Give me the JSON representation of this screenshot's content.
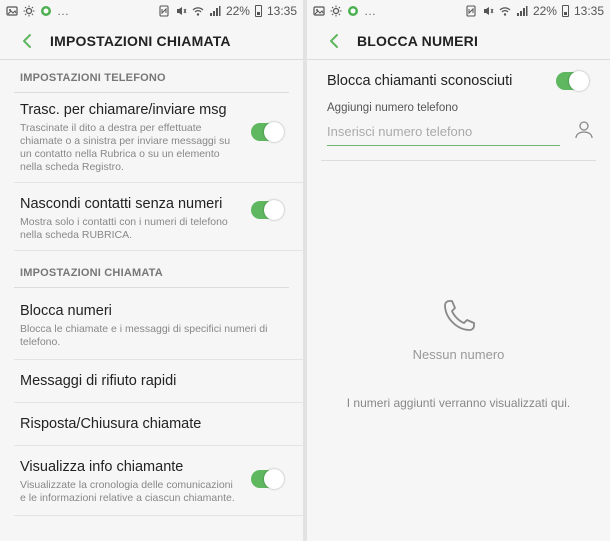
{
  "status_bar": {
    "battery": "22%",
    "time": "13:35"
  },
  "left": {
    "title": "IMPOSTAZIONI CHIAMATA",
    "section_phone": "IMPOSTAZIONI TELEFONO",
    "section_call": "IMPOSTAZIONI CHIAMATA",
    "items": [
      {
        "title": "Trasc. per chiamare/inviare msg",
        "subtitle": "Trascinate il dito a destra per effettuate chiamate o a sinistra per inviare messaggi su un contatto nella Rubrica o su un elemento nella scheda Registro.",
        "toggle": true
      },
      {
        "title": "Nascondi contatti senza numeri",
        "subtitle": "Mostra solo i contatti con i numeri di telefono nella scheda RUBRICA.",
        "toggle": true
      },
      {
        "title": "Blocca numeri",
        "subtitle": "Blocca le chiamate e i messaggi di specifici numeri di telefono."
      },
      {
        "title": "Messaggi di rifiuto rapidi"
      },
      {
        "title": "Risposta/Chiusura chiamate"
      },
      {
        "title": "Visualizza info chiamante",
        "subtitle": "Visualizzate la cronologia delle comunicazioni e le informazioni relative a ciascun chiamante.",
        "toggle": true
      }
    ]
  },
  "right": {
    "title": "BLOCCA NUMERI",
    "block_unknown": "Blocca chiamanti sconosciuti",
    "block_unknown_on": true,
    "field_label": "Aggiungi numero telefono",
    "field_placeholder": "Inserisci numero telefono",
    "empty_title": "Nessun numero",
    "empty_note": "I numeri aggiunti verranno visualizzati qui."
  },
  "colors": {
    "accent": "#5fb760",
    "background": "#f6f6f6"
  },
  "icons": [
    "back-arrow-icon",
    "phone-icon",
    "contact-icon",
    "wifi-icon",
    "battery-icon"
  ]
}
